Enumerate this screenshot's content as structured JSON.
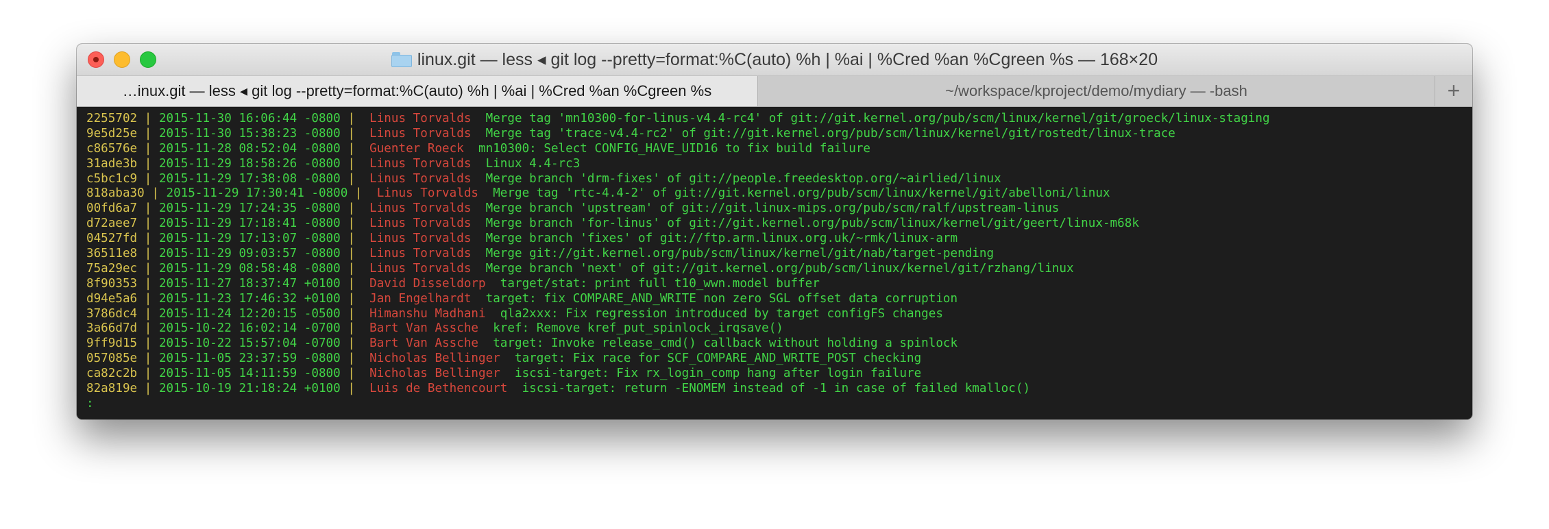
{
  "window": {
    "title_prefix": "linux.git — less",
    "title_sep": "◂",
    "title_rest": "git log --pretty=format:%C(auto) %h | %ai | %Cred %an %Cgreen %s — 168×20"
  },
  "tabs": [
    {
      "label": "…inux.git — less ◂ git log --pretty=format:%C(auto) %h | %ai | %Cred %an %Cgreen %s"
    },
    {
      "label": "~/workspace/kproject/demo/mydiary — -bash"
    }
  ],
  "new_tab_label": "+",
  "commits": [
    {
      "hash": "2255702",
      "date": "2015-11-30 16:06:44 -0800",
      "author": "Linus Torvalds",
      "subject": "Merge tag 'mn10300-for-linus-v4.4-rc4' of git://git.kernel.org/pub/scm/linux/kernel/git/groeck/linux-staging"
    },
    {
      "hash": "9e5d25e",
      "date": "2015-11-30 15:38:23 -0800",
      "author": "Linus Torvalds",
      "subject": "Merge tag 'trace-v4.4-rc2' of git://git.kernel.org/pub/scm/linux/kernel/git/rostedt/linux-trace"
    },
    {
      "hash": "c86576e",
      "date": "2015-11-28 08:52:04 -0800",
      "author": "Guenter Roeck",
      "subject": "mn10300: Select CONFIG_HAVE_UID16 to fix build failure"
    },
    {
      "hash": "31ade3b",
      "date": "2015-11-29 18:58:26 -0800",
      "author": "Linus Torvalds",
      "subject": "Linux 4.4-rc3"
    },
    {
      "hash": "c5bc1c9",
      "date": "2015-11-29 17:38:08 -0800",
      "author": "Linus Torvalds",
      "subject": "Merge branch 'drm-fixes' of git://people.freedesktop.org/~airlied/linux"
    },
    {
      "hash": "818aba30",
      "date": "2015-11-29 17:30:41 -0800",
      "author": "Linus Torvalds",
      "subject": "Merge tag 'rtc-4.4-2' of git://git.kernel.org/pub/scm/linux/kernel/git/abelloni/linux"
    },
    {
      "hash": "00fd6a7",
      "date": "2015-11-29 17:24:35 -0800",
      "author": "Linus Torvalds",
      "subject": "Merge branch 'upstream' of git://git.linux-mips.org/pub/scm/ralf/upstream-linus"
    },
    {
      "hash": "d72aee7",
      "date": "2015-11-29 17:18:41 -0800",
      "author": "Linus Torvalds",
      "subject": "Merge branch 'for-linus' of git://git.kernel.org/pub/scm/linux/kernel/git/geert/linux-m68k"
    },
    {
      "hash": "04527fd",
      "date": "2015-11-29 17:13:07 -0800",
      "author": "Linus Torvalds",
      "subject": "Merge branch 'fixes' of git://ftp.arm.linux.org.uk/~rmk/linux-arm"
    },
    {
      "hash": "36511e8",
      "date": "2015-11-29 09:03:57 -0800",
      "author": "Linus Torvalds",
      "subject": "Merge git://git.kernel.org/pub/scm/linux/kernel/git/nab/target-pending"
    },
    {
      "hash": "75a29ec",
      "date": "2015-11-29 08:58:48 -0800",
      "author": "Linus Torvalds",
      "subject": "Merge branch 'next' of git://git.kernel.org/pub/scm/linux/kernel/git/rzhang/linux"
    },
    {
      "hash": "8f90353",
      "date": "2015-11-27 18:37:47 +0100",
      "author": "David Disseldorp",
      "subject": "target/stat: print full t10_wwn.model buffer"
    },
    {
      "hash": "d94e5a6",
      "date": "2015-11-23 17:46:32 +0100",
      "author": "Jan Engelhardt",
      "subject": "target: fix COMPARE_AND_WRITE non zero SGL offset data corruption"
    },
    {
      "hash": "3786dc4",
      "date": "2015-11-24 12:20:15 -0500",
      "author": "Himanshu Madhani",
      "subject": "qla2xxx: Fix regression introduced by target configFS changes"
    },
    {
      "hash": "3a66d7d",
      "date": "2015-10-22 16:02:14 -0700",
      "author": "Bart Van Assche",
      "subject": "kref: Remove kref_put_spinlock_irqsave()"
    },
    {
      "hash": "9ff9d15",
      "date": "2015-10-22 15:57:04 -0700",
      "author": "Bart Van Assche",
      "subject": "target: Invoke release_cmd() callback without holding a spinlock"
    },
    {
      "hash": "057085e",
      "date": "2015-11-05 23:37:59 -0800",
      "author": "Nicholas Bellinger",
      "subject": "target: Fix race for SCF_COMPARE_AND_WRITE_POST checking"
    },
    {
      "hash": "ca82c2b",
      "date": "2015-11-05 14:11:59 -0800",
      "author": "Nicholas Bellinger",
      "subject": "iscsi-target: Fix rx_login_comp hang after login failure"
    },
    {
      "hash": "82a819e",
      "date": "2015-10-19 21:18:24 +0100",
      "author": "Luis de Bethencourt",
      "subject": "iscsi-target: return -ENOMEM instead of -1 in case of failed kmalloc()"
    }
  ],
  "prompt": ":",
  "colors": {
    "hash": "#d8c34e",
    "date": "#41d346",
    "author": "#d6473c",
    "subject": "#41d346",
    "background": "#1d1d1d"
  }
}
